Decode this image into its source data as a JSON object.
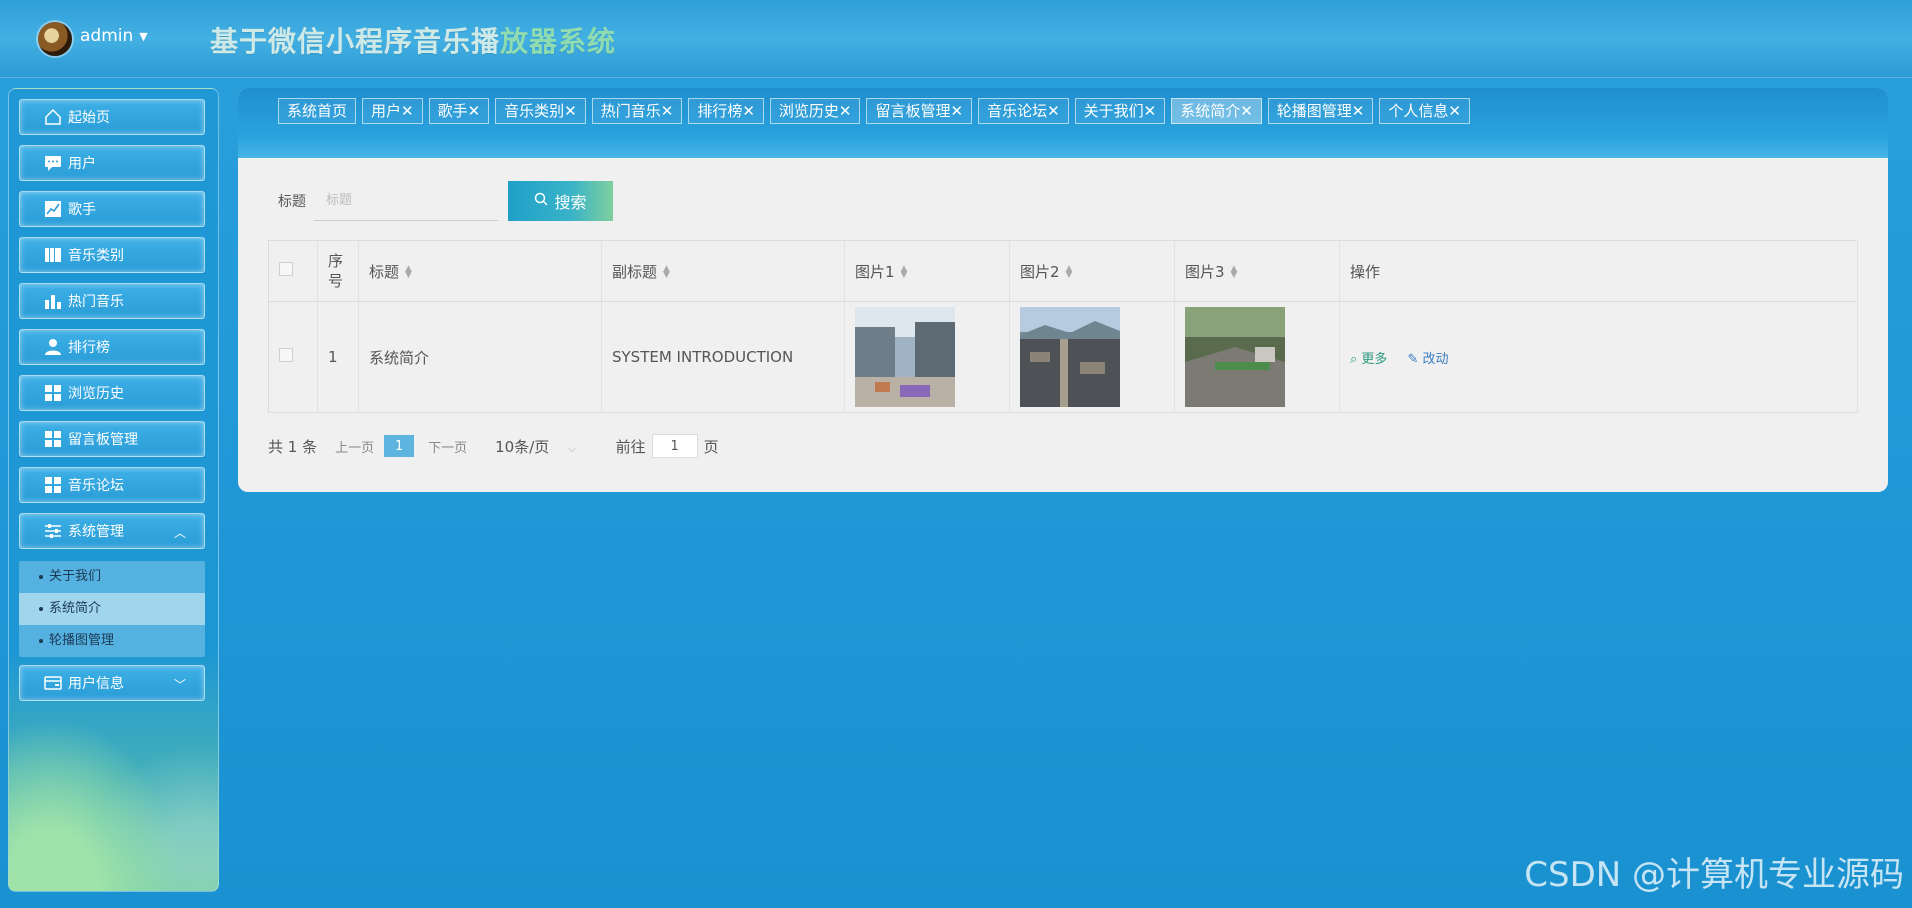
{
  "header": {
    "username": "admin",
    "title_part1": "基于微信小程序音乐播",
    "title_part2": "放器系统"
  },
  "sidebar": {
    "items": [
      {
        "label": "起始页",
        "icon": "home-icon"
      },
      {
        "label": "用户",
        "icon": "chat-icon"
      },
      {
        "label": "歌手",
        "icon": "chart-line-icon"
      },
      {
        "label": "音乐类别",
        "icon": "book-icon"
      },
      {
        "label": "热门音乐",
        "icon": "bar-chart-icon"
      },
      {
        "label": "排行榜",
        "icon": "user-icon"
      },
      {
        "label": "浏览历史",
        "icon": "grid-icon"
      },
      {
        "label": "留言板管理",
        "icon": "grid-icon"
      },
      {
        "label": "音乐论坛",
        "icon": "grid-icon"
      },
      {
        "label": "系统管理",
        "icon": "sliders-icon"
      },
      {
        "label": "用户信息",
        "icon": "card-icon"
      }
    ],
    "submenu": [
      "关于我们",
      "系统简介",
      "轮播图管理"
    ]
  },
  "tabs": [
    "系统首页",
    "用户✕",
    "歌手✕",
    "音乐类别✕",
    "热门音乐✕",
    "排行榜✕",
    "浏览历史✕",
    "留言板管理✕",
    "音乐论坛✕",
    "关于我们✕",
    "系统简介✕",
    "轮播图管理✕",
    "个人信息✕"
  ],
  "search": {
    "label": "标题",
    "placeholder": "标题",
    "button": "搜索"
  },
  "table": {
    "headers": [
      "序号",
      "标题",
      "副标题",
      "图片1",
      "图片2",
      "图片3",
      "操作"
    ],
    "rows": [
      {
        "index": "1",
        "title": "系统简介",
        "subtitle": "SYSTEM INTRODUCTION"
      }
    ],
    "op_more": "更多",
    "op_edit": "改动"
  },
  "pager": {
    "total": "共 1 条",
    "prev": "上一页",
    "current": "1",
    "next": "下一页",
    "size": "10条/页",
    "goto": "前往",
    "goto_value": "1",
    "page": "页"
  },
  "watermark": "CSDN @计算机专业源码",
  "colors": {
    "accent": "#1f97d6",
    "button": "#39b3c8"
  }
}
